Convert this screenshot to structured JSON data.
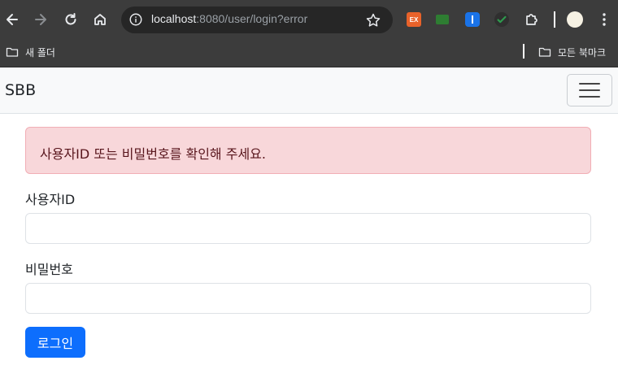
{
  "browser": {
    "url_host": "localhost",
    "url_rest": ":8080/user/login?error",
    "extensions": [
      {
        "name": "ex-extension-icon",
        "label": "EX",
        "color": "#e8622a"
      },
      {
        "name": "green-extension-icon",
        "label": "",
        "color": "#2e7d32"
      },
      {
        "name": "shield-extension-icon",
        "label": "",
        "color": "#1a73e8"
      },
      {
        "name": "check-extension-icon",
        "label": "",
        "color": "#2e9b4e"
      }
    ],
    "bookmarks": {
      "left_folder": "새 폴더",
      "right_folder": "모든 북마크"
    }
  },
  "navbar": {
    "brand": "SBB"
  },
  "alert": {
    "message": "사용자ID 또는 비밀번호를 확인해 주세요."
  },
  "form": {
    "username_label": "사용자ID",
    "username_value": "",
    "password_label": "비밀번호",
    "password_value": "",
    "submit_label": "로그인"
  }
}
